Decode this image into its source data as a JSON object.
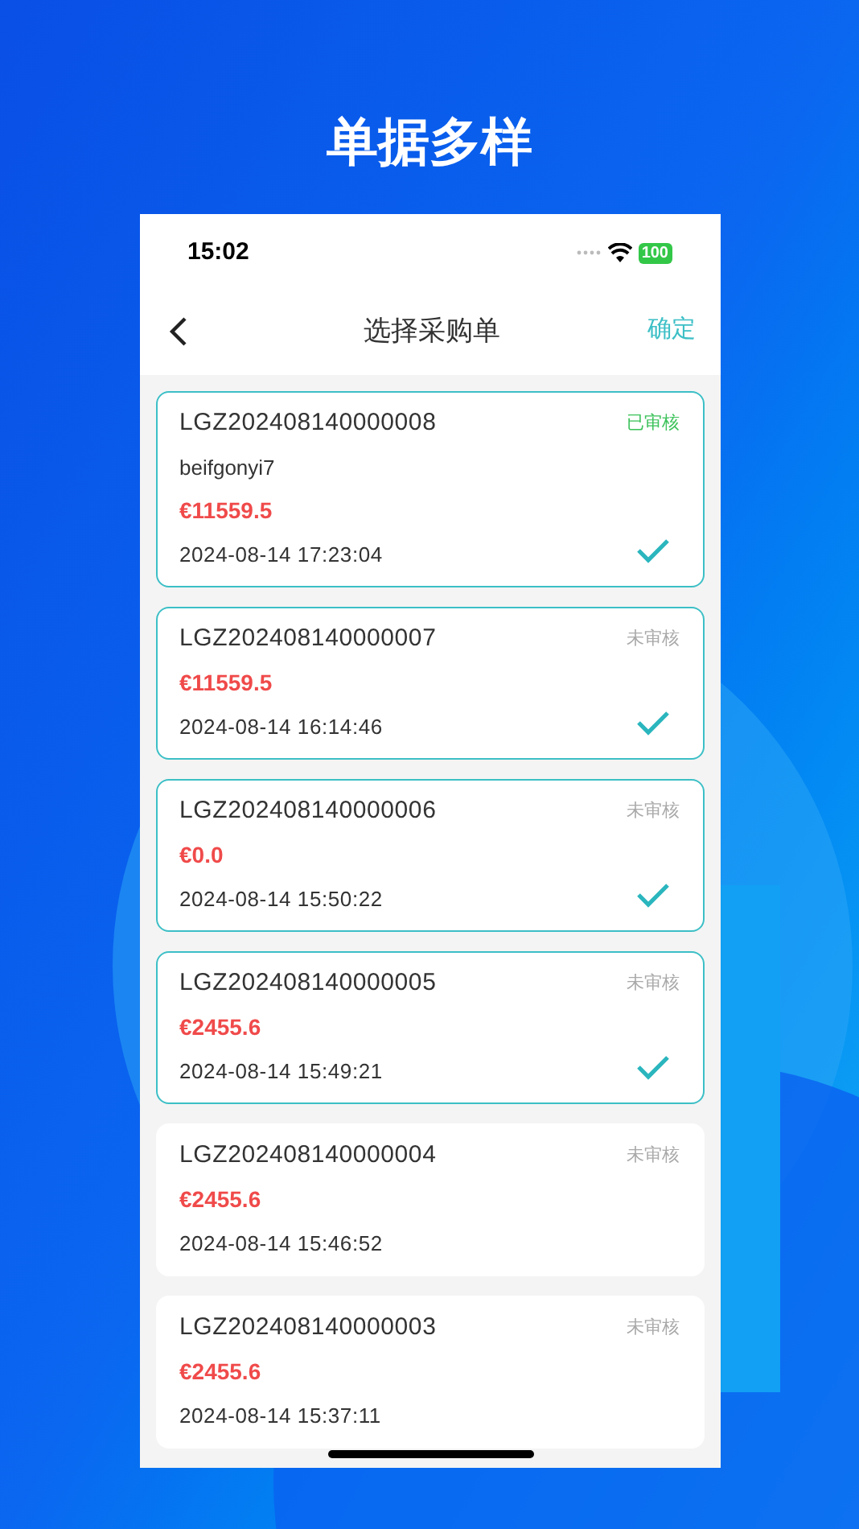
{
  "headline": "单据多样",
  "status_bar": {
    "time": "15:02",
    "battery": "100"
  },
  "nav": {
    "title": "选择采购单",
    "confirm": "确定"
  },
  "orders": [
    {
      "number": "LGZ202408140000008",
      "status": "已审核",
      "approved": true,
      "supplier": "beifgonyi7",
      "amount": "€11559.5",
      "time": "2024-08-14 17:23:04",
      "selected": true
    },
    {
      "number": "LGZ202408140000007",
      "status": "未审核",
      "approved": false,
      "amount": "€11559.5",
      "time": "2024-08-14 16:14:46",
      "selected": true
    },
    {
      "number": "LGZ202408140000006",
      "status": "未审核",
      "approved": false,
      "amount": "€0.0",
      "time": "2024-08-14 15:50:22",
      "selected": true
    },
    {
      "number": "LGZ202408140000005",
      "status": "未审核",
      "approved": false,
      "amount": "€2455.6",
      "time": "2024-08-14 15:49:21",
      "selected": true
    },
    {
      "number": "LGZ202408140000004",
      "status": "未审核",
      "approved": false,
      "amount": "€2455.6",
      "time": "2024-08-14 15:46:52",
      "selected": false
    },
    {
      "number": "LGZ202408140000003",
      "status": "未审核",
      "approved": false,
      "amount": "€2455.6",
      "time": "2024-08-14 15:37:11",
      "selected": false
    }
  ]
}
